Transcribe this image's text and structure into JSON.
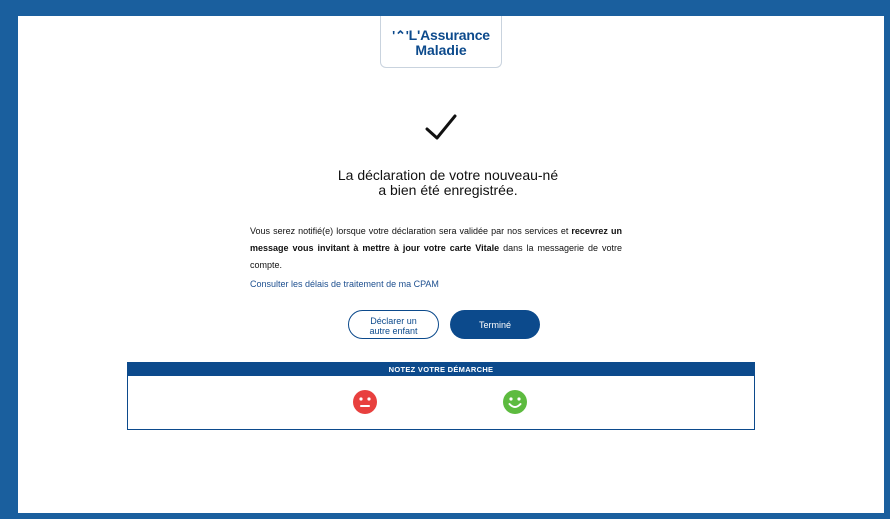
{
  "logo": {
    "line1": "L'Assurance",
    "line2": "Maladie"
  },
  "confirmation": {
    "title_line1": "La déclaration de votre nouveau-né",
    "title_line2": "a bien été enregistrée.",
    "message_part1": "Vous serez notifié(e) lorsque votre déclaration sera validée par nos services et",
    "message_bold": "recevrez un message vous invitant à mettre à jour votre carte Vitale",
    "message_part2": "dans la messagerie de votre compte.",
    "link_label": "Consulter les délais de traitement de ma CPAM"
  },
  "actions": {
    "declare_other_line1": "Déclarer un",
    "declare_other_line2": "autre enfant",
    "done_label": "Terminé"
  },
  "rating": {
    "title": "NOTEZ VOTRE DÉMARCHE",
    "colors": {
      "neutral": "#e8403e",
      "happy": "#5dbb3f"
    }
  },
  "colors": {
    "brand": "#0c4a8c",
    "background": "#1a5f9e"
  }
}
